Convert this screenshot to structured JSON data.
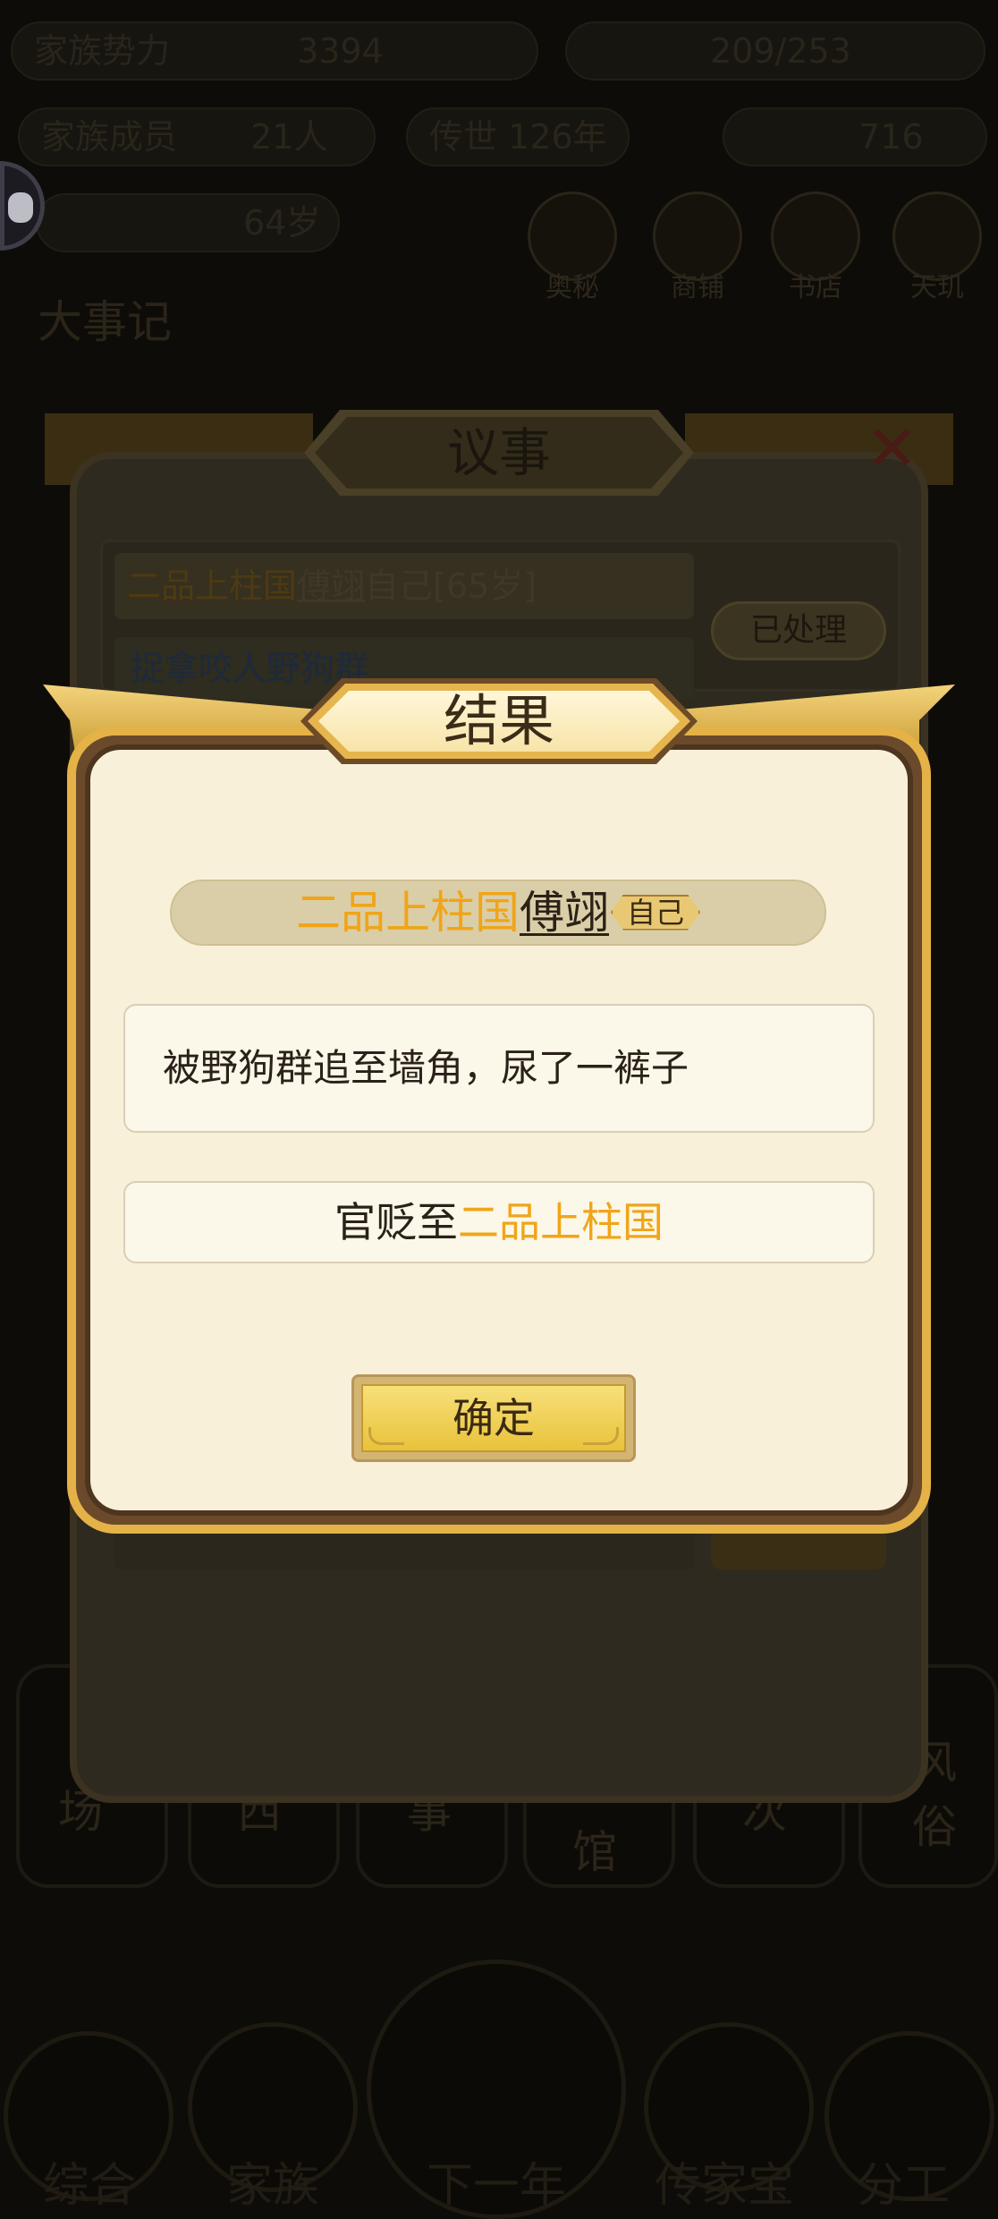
{
  "dialog": {
    "title": "结果",
    "person": {
      "rank": "二品上柱国",
      "name": "傅翊",
      "tag": "自己"
    },
    "message": "被野狗群追至墙角，尿了一裤子",
    "demotion": {
      "prefix": "官贬至",
      "rank": "二品上柱国"
    },
    "confirm_label": "确定"
  },
  "background_dialog": {
    "title": "议事",
    "row": {
      "rank": "二品上柱国",
      "name": "傅翊",
      "tag": "自己",
      "age": "[65岁]"
    },
    "task": "捉拿咬人野狗群",
    "status_button": "已处理"
  },
  "background": {
    "header": {
      "clan_power_label": "家族势力",
      "clan_power_value": "3394",
      "clan_members_label": "家族成员",
      "clan_members_value": "21人",
      "era_label": "传世",
      "era_value": "126年",
      "resource_a": "209/253",
      "resource_b": "716",
      "age_value": "64岁"
    },
    "title": "大事记",
    "top_icons": [
      "奥秘",
      "商铺",
      "书店",
      "天玑"
    ],
    "tiles": [
      "场",
      "西",
      "事",
      "馆",
      "次",
      "风俗"
    ],
    "nav": [
      "综合",
      "家族",
      "下一年",
      "传家宝",
      "分工"
    ]
  },
  "colors": {
    "gold_rank": "#f0a518",
    "dialog_bg": "#f8f0d9",
    "frame_gold": "#e5b248"
  }
}
